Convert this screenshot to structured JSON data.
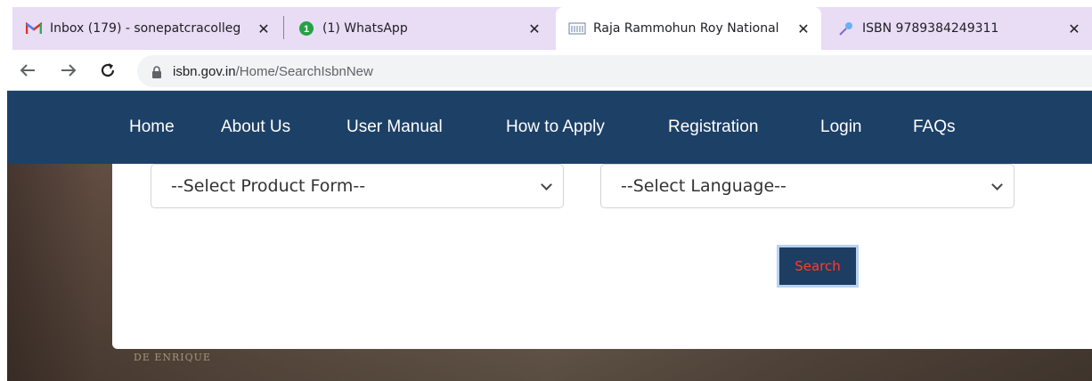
{
  "browser": {
    "tabs": [
      {
        "title": "Inbox (179) - sonepatcracolleg",
        "icon": "gmail-icon",
        "close": "✕",
        "active": false
      },
      {
        "title": "(1) WhatsApp",
        "icon": "whatsapp-icon",
        "badge": "1",
        "close": "✕",
        "active": false
      },
      {
        "title": "Raja Rammohun Roy National",
        "icon": "library-icon",
        "close": "✕",
        "active": true
      },
      {
        "title": "ISBN 9789384249311",
        "icon": "pin-icon",
        "close": "✕",
        "active": false
      }
    ],
    "address": {
      "host": "isbn.gov.in",
      "path": "/Home/SearchIsbnNew"
    }
  },
  "site": {
    "nav": [
      "Home",
      "About Us",
      "User Manual",
      "How to Apply",
      "Registration",
      "Login",
      "FAQs"
    ],
    "colors": {
      "nav_bg": "#1d4066",
      "button_bg": "#1d3d62",
      "button_text": "#ff3b30"
    }
  },
  "form": {
    "product_form": {
      "value": "--Select Product Form--"
    },
    "language": {
      "value": "--Select Language--"
    },
    "search_label": "Search"
  },
  "background": {
    "book_text": "DE ENRIQUE"
  }
}
